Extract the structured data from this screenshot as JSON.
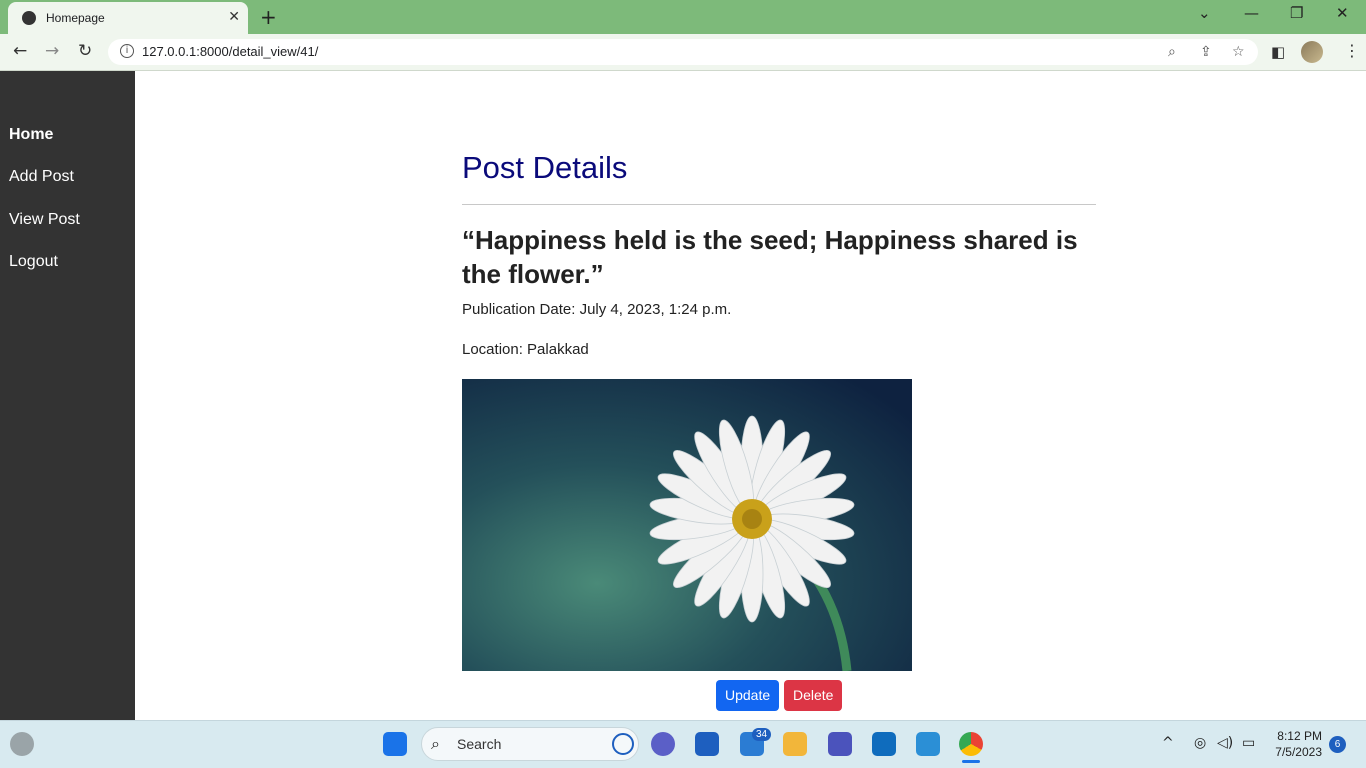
{
  "browser": {
    "tab_title": "Homepage",
    "tab_close": "✕",
    "new_tab": "+",
    "url": "127.0.0.1:8000/detail_view/41/",
    "window_controls": [
      "⌄",
      "—",
      "❐",
      "✕"
    ]
  },
  "sidebar": {
    "items": [
      {
        "label": "Home",
        "active": true
      },
      {
        "label": "Add Post",
        "active": false
      },
      {
        "label": "View Post",
        "active": false
      },
      {
        "label": "Logout",
        "active": false
      }
    ]
  },
  "main": {
    "heading": "Post Details",
    "post_title": "“Happiness held is the seed; Happiness shared is the flower.”",
    "publication": "Publication Date: July 4, 2023, 1:24 p.m.",
    "location": "Location: Palakkad",
    "image": {
      "subject": "daisy-flower",
      "colors": {
        "background": "#1f4e57",
        "petals": "#f2f2f2",
        "center": "#c9a11a"
      }
    },
    "buttons": {
      "update": "Update",
      "delete": "Delete"
    },
    "colors": {
      "heading": "#0a0a7a",
      "update": "#1266f1",
      "delete": "#dc3545",
      "sidebar": "#333333"
    }
  },
  "taskbar": {
    "search_label": "Search",
    "mail_badge": "34",
    "time": "8:12 PM",
    "date": "7/5/2023",
    "notifications": "6"
  }
}
